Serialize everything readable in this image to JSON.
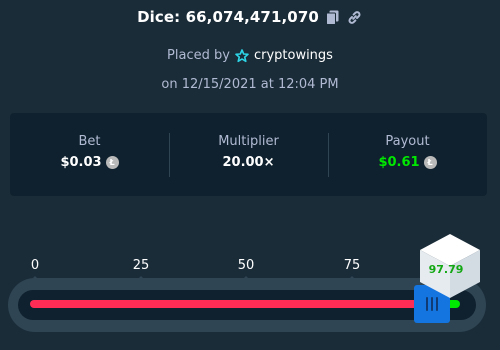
{
  "header": {
    "title": "Dice: 66,074,471,070",
    "copy_icon": "copy-icon",
    "link_icon": "link-icon"
  },
  "placed": {
    "prefix": "Placed by",
    "user_icon": "star-badge-icon",
    "username": "cryptowings",
    "date": "on 12/15/2021 at 12:04 PM"
  },
  "stats": {
    "bet_label": "Bet",
    "bet_value": "$0.03",
    "multiplier_label": "Multiplier",
    "multiplier_value": "20.00×",
    "payout_label": "Payout",
    "payout_value": "$0.61",
    "currency_icon": "litecoin-icon"
  },
  "slider": {
    "ticks": [
      "0",
      "25",
      "50",
      "75"
    ],
    "target_value": 95,
    "result": "97.79",
    "colors": {
      "lose": "#ff2c55",
      "win": "#00e701",
      "handle": "#1475e1"
    }
  }
}
